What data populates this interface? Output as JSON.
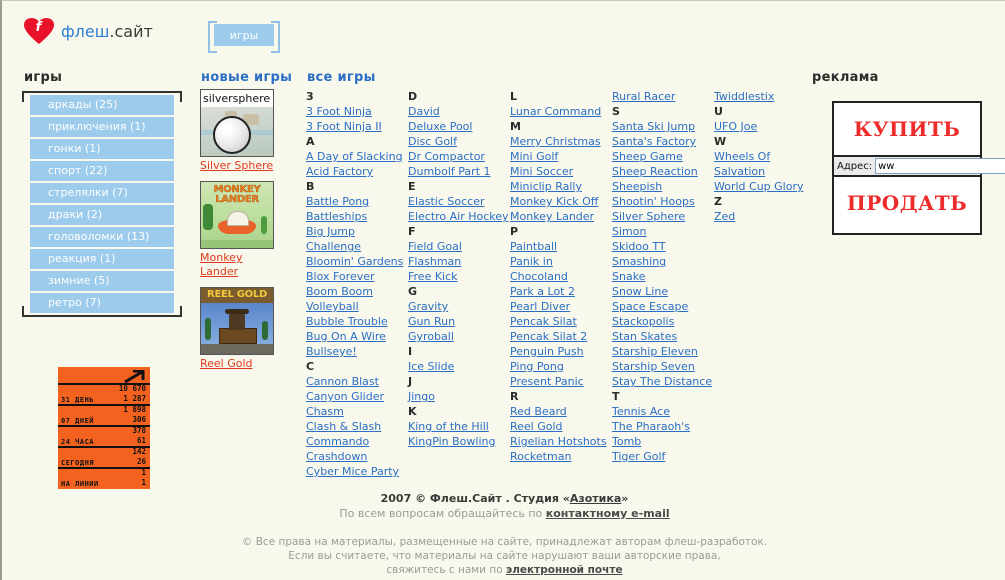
{
  "site": {
    "logo_main": "флеш",
    "logo_suffix": ".сайт",
    "logo_heart_letter": "f"
  },
  "header": {
    "tab_label": "игры"
  },
  "sidebar": {
    "title": "игры",
    "items": [
      {
        "label": "аркады (25)"
      },
      {
        "label": "приключения (1)"
      },
      {
        "label": "гонки (1)"
      },
      {
        "label": "спорт (22)"
      },
      {
        "label": "стрелялки (7)"
      },
      {
        "label": "драки (2)"
      },
      {
        "label": "головоломки (13)"
      },
      {
        "label": "реакция (1)"
      },
      {
        "label": "зимние (5)"
      },
      {
        "label": "ретро (7)"
      }
    ]
  },
  "counter": {
    "rows": [
      {
        "label": "31 ДЕНЬ",
        "hits": "10 670",
        "hosts": "1 287"
      },
      {
        "label": "07 ДНЕЙ",
        "hits": "1 898",
        "hosts": "306"
      },
      {
        "label": "24 ЧАСА",
        "hits": "378",
        "hosts": "61"
      },
      {
        "label": "СЕГОДНЯ",
        "hits": "142",
        "hosts": "26"
      },
      {
        "label": "НА ЛИНИИ",
        "hits": "1",
        "hosts": "1"
      }
    ]
  },
  "new_games": {
    "title": "новые игры",
    "items": [
      {
        "label": "Silver Sphere",
        "thumb_caption": "silversphere"
      },
      {
        "label": "Monkey Lander",
        "thumb_caption": "MONKEY LANDER"
      },
      {
        "label": "Reel Gold",
        "thumb_caption": "REEL GOLD"
      }
    ]
  },
  "all_games": {
    "title": "все игры",
    "columns": [
      {
        "entries": [
          {
            "type": "letter",
            "text": "3"
          },
          {
            "type": "game",
            "text": "3 Foot Ninja"
          },
          {
            "type": "game",
            "text": "3 Foot Ninja II"
          },
          {
            "type": "letter",
            "text": "A"
          },
          {
            "type": "game",
            "text": "A Day of Slacking"
          },
          {
            "type": "game",
            "text": "Acid Factory"
          },
          {
            "type": "letter",
            "text": "B"
          },
          {
            "type": "game",
            "text": "Battle Pong"
          },
          {
            "type": "game",
            "text": "Battleships"
          },
          {
            "type": "game",
            "text": "Big Jump Challenge"
          },
          {
            "type": "game",
            "text": "Bloomin' Gardens"
          },
          {
            "type": "game",
            "text": "Blox Forever"
          },
          {
            "type": "game",
            "text": "Boom Boom Volleyball"
          },
          {
            "type": "game",
            "text": "Bubble Trouble"
          },
          {
            "type": "game",
            "text": "Bug On A Wire"
          },
          {
            "type": "game",
            "text": "Bullseye!"
          },
          {
            "type": "letter",
            "text": "C"
          },
          {
            "type": "game",
            "text": "Cannon Blast"
          },
          {
            "type": "game",
            "text": "Canyon Glider"
          },
          {
            "type": "game",
            "text": "Chasm"
          },
          {
            "type": "game",
            "text": "Clash & Slash"
          },
          {
            "type": "game",
            "text": "Commando"
          },
          {
            "type": "game",
            "text": "Crashdown"
          },
          {
            "type": "game",
            "text": "Cyber Mice Party"
          }
        ]
      },
      {
        "entries": [
          {
            "type": "letter",
            "text": "D"
          },
          {
            "type": "game",
            "text": "David"
          },
          {
            "type": "game",
            "text": "Deluxe Pool"
          },
          {
            "type": "game",
            "text": "Disc Golf"
          },
          {
            "type": "game",
            "text": "Dr Compactor"
          },
          {
            "type": "game",
            "text": "Dumbolf Part 1"
          },
          {
            "type": "letter",
            "text": "E"
          },
          {
            "type": "game",
            "text": "Elastic Soccer"
          },
          {
            "type": "game",
            "text": "Electro Air Hockey"
          },
          {
            "type": "letter",
            "text": "F"
          },
          {
            "type": "game",
            "text": "Field Goal"
          },
          {
            "type": "game",
            "text": "Flashman"
          },
          {
            "type": "game",
            "text": "Free Kick"
          },
          {
            "type": "letter",
            "text": "G"
          },
          {
            "type": "game",
            "text": "Gravity"
          },
          {
            "type": "game",
            "text": "Gun Run"
          },
          {
            "type": "game",
            "text": "Gyroball"
          },
          {
            "type": "letter",
            "text": "I"
          },
          {
            "type": "game",
            "text": "Ice Slide"
          },
          {
            "type": "letter",
            "text": "J"
          },
          {
            "type": "game",
            "text": "Jingo"
          },
          {
            "type": "letter",
            "text": "K"
          },
          {
            "type": "game",
            "text": "King of the Hill"
          },
          {
            "type": "game",
            "text": "KingPin Bowling"
          }
        ]
      },
      {
        "entries": [
          {
            "type": "letter",
            "text": "L"
          },
          {
            "type": "game",
            "text": "Lunar Command"
          },
          {
            "type": "letter",
            "text": "M"
          },
          {
            "type": "game",
            "text": "Merry Christmas"
          },
          {
            "type": "game",
            "text": "Mini Golf"
          },
          {
            "type": "game",
            "text": "Mini Soccer"
          },
          {
            "type": "game",
            "text": "Miniclip Rally"
          },
          {
            "type": "game",
            "text": "Monkey Kick Off"
          },
          {
            "type": "game",
            "text": "Monkey Lander"
          },
          {
            "type": "letter",
            "text": "P"
          },
          {
            "type": "game",
            "text": "Paintball"
          },
          {
            "type": "game",
            "text": "Panik in Chocoland"
          },
          {
            "type": "game",
            "text": "Park a Lot 2"
          },
          {
            "type": "game",
            "text": "Pearl Diver"
          },
          {
            "type": "game",
            "text": "Pencak Silat"
          },
          {
            "type": "game",
            "text": "Pencak Silat 2"
          },
          {
            "type": "game",
            "text": "Penguin Push"
          },
          {
            "type": "game",
            "text": "Ping Pong"
          },
          {
            "type": "game",
            "text": "Present Panic"
          },
          {
            "type": "letter",
            "text": "R"
          },
          {
            "type": "game",
            "text": "Red Beard"
          },
          {
            "type": "game",
            "text": "Reel Gold"
          },
          {
            "type": "game",
            "text": "Rigelian Hotshots"
          },
          {
            "type": "game",
            "text": "Rocketman"
          }
        ]
      },
      {
        "entries": [
          {
            "type": "game",
            "text": "Rural Racer"
          },
          {
            "type": "letter",
            "text": "S"
          },
          {
            "type": "game",
            "text": "Santa Ski Jump"
          },
          {
            "type": "game",
            "text": "Santa's Factory"
          },
          {
            "type": "game",
            "text": "Sheep Game"
          },
          {
            "type": "game",
            "text": "Sheep Reaction"
          },
          {
            "type": "game",
            "text": "Sheepish"
          },
          {
            "type": "game",
            "text": "Shootin' Hoops"
          },
          {
            "type": "game",
            "text": "Silver Sphere"
          },
          {
            "type": "game",
            "text": "Simon"
          },
          {
            "type": "game",
            "text": "Skidoo TT"
          },
          {
            "type": "game",
            "text": "Smashing"
          },
          {
            "type": "game",
            "text": "Snake"
          },
          {
            "type": "game",
            "text": "Snow Line"
          },
          {
            "type": "game",
            "text": "Space Escape"
          },
          {
            "type": "game",
            "text": "Stackopolis"
          },
          {
            "type": "game",
            "text": "Stan Skates"
          },
          {
            "type": "game",
            "text": "Starship Eleven"
          },
          {
            "type": "game",
            "text": "Starship Seven"
          },
          {
            "type": "game",
            "text": "Stay The Distance"
          },
          {
            "type": "letter",
            "text": "T"
          },
          {
            "type": "game",
            "text": "Tennis Ace"
          },
          {
            "type": "game",
            "text": "The Pharaoh's Tomb"
          },
          {
            "type": "game",
            "text": "Tiger Golf"
          }
        ]
      },
      {
        "entries": [
          {
            "type": "game",
            "text": "Twiddlestix"
          },
          {
            "type": "letter",
            "text": "U"
          },
          {
            "type": "game",
            "text": "UFO Joe"
          },
          {
            "type": "letter",
            "text": "W"
          },
          {
            "type": "game",
            "text": "Wheels Of Salvation"
          },
          {
            "type": "game",
            "text": "World Cup Glory"
          },
          {
            "type": "letter",
            "text": "Z"
          },
          {
            "type": "game",
            "text": "Zed"
          }
        ]
      }
    ]
  },
  "ad": {
    "title": "реклама",
    "buy_label": "КУПИТЬ",
    "sell_label": "ПРОДАТЬ",
    "address_label": "Адрес:",
    "address_value": "ww",
    "go_icon": "arrow-right-icon"
  },
  "footer": {
    "line1_prefix": "2007 © Флеш.Сайт . Студия «",
    "line1_link": "Азотика",
    "line1_suffix": "»",
    "line2_prefix": "По всем вопросам обращайтесь по ",
    "line2_link": "контактному e-mail",
    "legal_line1": "© Все права на материалы, размещенные на сайте, принадлежат авторам флеш-разработок.",
    "legal_line2": "Если вы считаете, что материалы на сайте нарушают ваши авторские права,",
    "legal_line3_prefix": "свяжитесь с нами по ",
    "legal_line3_link": "электронной почте"
  },
  "colors": {
    "page_bg": "#f9f8ec",
    "accent_blue": "#9ccbeb",
    "link_blue": "#2a6fc4",
    "link_red": "#e03a1e",
    "counter_orange": "#f4621f",
    "ad_red": "#ee2b2b"
  }
}
